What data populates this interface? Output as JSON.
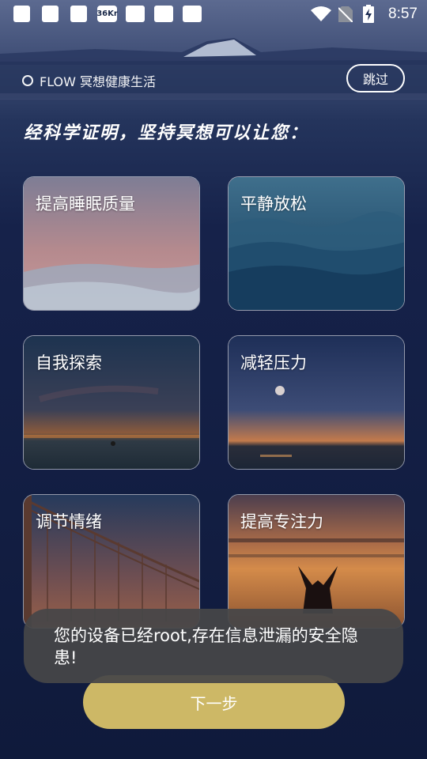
{
  "status_bar": {
    "time": "8:57",
    "app_badge": "36Kr",
    "icons": [
      "notification-square-icon",
      "notification-square-icon",
      "notification-square-icon",
      "kr-app-icon",
      "notification-square-icon",
      "notification-square-icon",
      "notification-square-icon",
      "wifi-icon",
      "no-sim-icon",
      "battery-charging-icon"
    ]
  },
  "header": {
    "brand_text": "FLOW 冥想健康生活",
    "skip_label": "跳过"
  },
  "headline": "经科学证明，坚持冥想可以让您：",
  "cards": [
    {
      "label": "提高睡眠质量"
    },
    {
      "label": "平静放松"
    },
    {
      "label": "自我探索"
    },
    {
      "label": "减轻压力"
    },
    {
      "label": "调节情绪"
    },
    {
      "label": "提高专注力"
    }
  ],
  "next_label": "下一步",
  "toast": "您的设备已经root,存在信息泄漏的安全隐患!",
  "colors": {
    "accent": "#cdb866",
    "background": "#101a38"
  }
}
